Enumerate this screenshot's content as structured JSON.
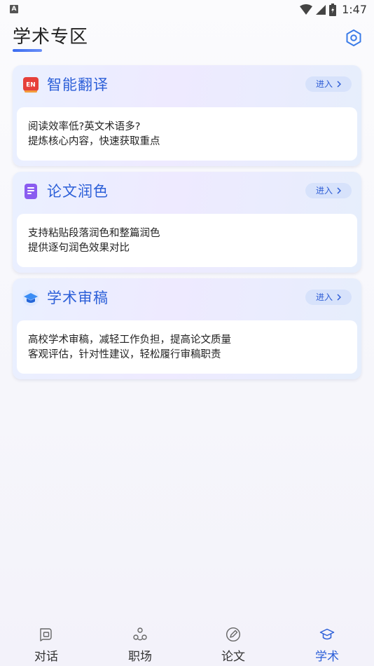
{
  "status_bar": {
    "left_badge": "A",
    "time": "1:47"
  },
  "header": {
    "title": "学术专区",
    "settings_icon": "settings-hexagon-icon"
  },
  "cards": [
    {
      "title": "智能翻译",
      "icon": "en-translate-icon",
      "button": "进入",
      "lines": [
        "阅读效率低?英文术语多?",
        "提炼核心内容，快速获取重点"
      ]
    },
    {
      "title": "论文润色",
      "icon": "document-polish-icon",
      "button": "进入",
      "lines": [
        "支持粘贴段落润色和整篇润色",
        "提供逐句润色效果对比"
      ]
    },
    {
      "title": "学术审稿",
      "icon": "graduation-cap-icon",
      "button": "进入",
      "lines": [
        "高校学术审稿，减轻工作负担，提高论文质量",
        "客观评估，针对性建议，轻松履行审稿职责"
      ]
    }
  ],
  "bottom_nav": [
    {
      "label": "对话",
      "icon": "chat-icon",
      "active": false
    },
    {
      "label": "职场",
      "icon": "workplace-icon",
      "active": false
    },
    {
      "label": "论文",
      "icon": "paper-edit-icon",
      "active": false
    },
    {
      "label": "学术",
      "icon": "academic-cap-icon",
      "active": true
    }
  ],
  "colors": {
    "accent": "#2c5fd8",
    "enter_bg": "#d7e2fb",
    "icon_red": "#e6403a",
    "icon_purple": "#8a5cf0",
    "icon_blue": "#3a8df5"
  }
}
